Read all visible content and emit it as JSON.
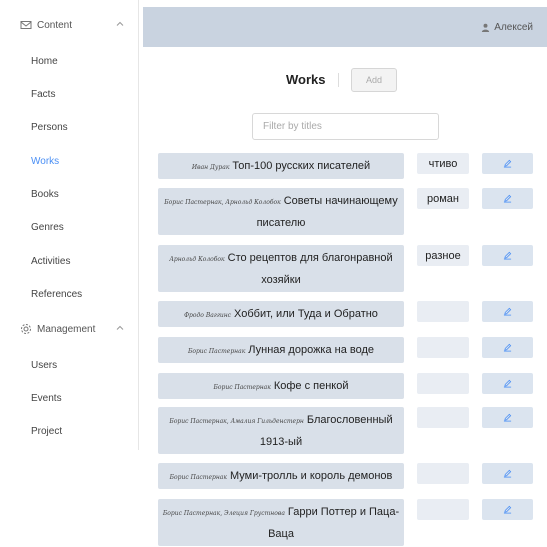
{
  "sidebar": {
    "content_group": {
      "label": "Content"
    },
    "content_items": [
      {
        "label": "Home"
      },
      {
        "label": "Facts"
      },
      {
        "label": "Persons"
      },
      {
        "label": "Works",
        "active": true
      },
      {
        "label": "Books"
      },
      {
        "label": "Genres"
      },
      {
        "label": "Activities"
      },
      {
        "label": "References"
      }
    ],
    "management_group": {
      "label": "Management"
    },
    "management_items": [
      {
        "label": "Users"
      },
      {
        "label": "Events"
      },
      {
        "label": "Project"
      }
    ]
  },
  "header": {
    "user_name": "Алексей"
  },
  "main": {
    "title": "Works",
    "add_label": "Add",
    "filter_placeholder": "Filter by titles",
    "works": [
      {
        "author": "Иван Дурак",
        "title": "Топ-100 русских писателей",
        "genre": "чтиво"
      },
      {
        "author": "Борис Пастернак, Арнольд Колобок",
        "title": "Советы начинающему писателю",
        "genre": "роман"
      },
      {
        "author": "Арнольд Колобок",
        "title": "Сто рецептов для благонравной хозяйки",
        "genre": "разное"
      },
      {
        "author": "Фродо Ваггинс",
        "title": "Хоббит, или Туда и Обратно",
        "genre": ""
      },
      {
        "author": "Борис Пастернак",
        "title": "Лунная дорожка на воде",
        "genre": ""
      },
      {
        "author": "Борис Пастернак",
        "title": "Кофе с пенкой",
        "genre": ""
      },
      {
        "author": "Борис Пастернак, Амалия Гильденстерн",
        "title": "Благословенный 1913-ый",
        "genre": ""
      },
      {
        "author": "Борис Пастернак",
        "title": "Муми-тролль и король демонов",
        "genre": ""
      },
      {
        "author": "Борис Пастернак, Элеция Грустнова",
        "title": "Гарри Поттер и Паца-Ваца",
        "genre": ""
      }
    ]
  },
  "colors": {
    "accent": "#4a8ff5",
    "header_bg": "#c9d3e0",
    "cell_bg": "#d9e0e9"
  },
  "icons": {
    "content": "mail-icon",
    "management": "gear-icon",
    "user": "user-icon",
    "edit": "pencil-icon"
  }
}
